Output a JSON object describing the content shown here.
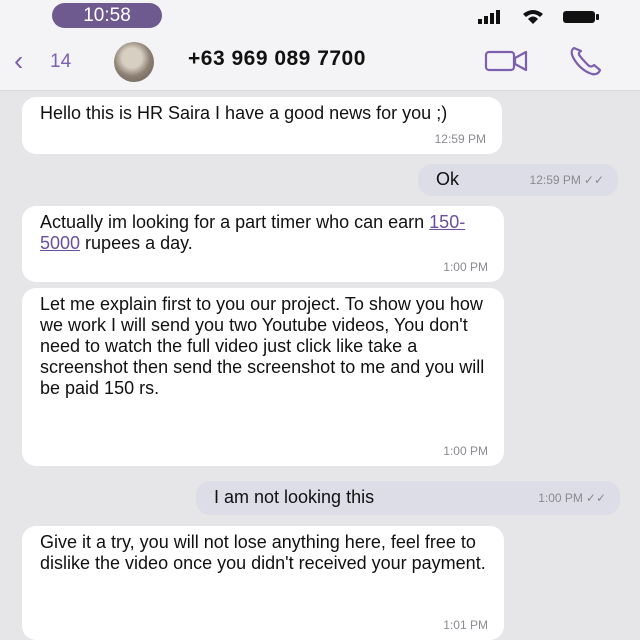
{
  "status_bar": {
    "time": "10:58",
    "icons": [
      "signal-icon",
      "wifi-icon",
      "battery-icon"
    ]
  },
  "header": {
    "back_count": "14",
    "contact_name": "+63 969 089 7700",
    "icons": [
      "back-chevron-icon",
      "video-call-icon",
      "phone-icon"
    ]
  },
  "messages": [
    {
      "direction": "in",
      "text": "Hello this is HR Saira I have a good news for you ;)",
      "time": "12:59 PM"
    },
    {
      "direction": "out",
      "text": "Ok",
      "time": "12:59 PM"
    },
    {
      "direction": "in",
      "text_before": "Actually im looking for a part timer who can earn ",
      "link": "150-5000",
      "text_after": " rupees a day.",
      "time": "1:00 PM"
    },
    {
      "direction": "in",
      "text": "Let me explain first to you our project. To show you how we work I will send you two Youtube videos, You don't need to watch the full video just click like take a screenshot then send the screenshot to me and you will be paid 150 rs.",
      "time": "1:00 PM"
    },
    {
      "direction": "out",
      "text": "I am not looking this",
      "time": "1:00 PM"
    },
    {
      "direction": "in",
      "text": "Give it a try, you will not lose anything here, feel free to dislike the video once you didn't received your payment.",
      "time": "1:01 PM"
    }
  ],
  "colors": {
    "accent": "#7d5fb0",
    "pill": "#6e5a8e",
    "incoming": "#ffffff",
    "outgoing": "#dcdde6",
    "background": "#e6e6e9"
  }
}
